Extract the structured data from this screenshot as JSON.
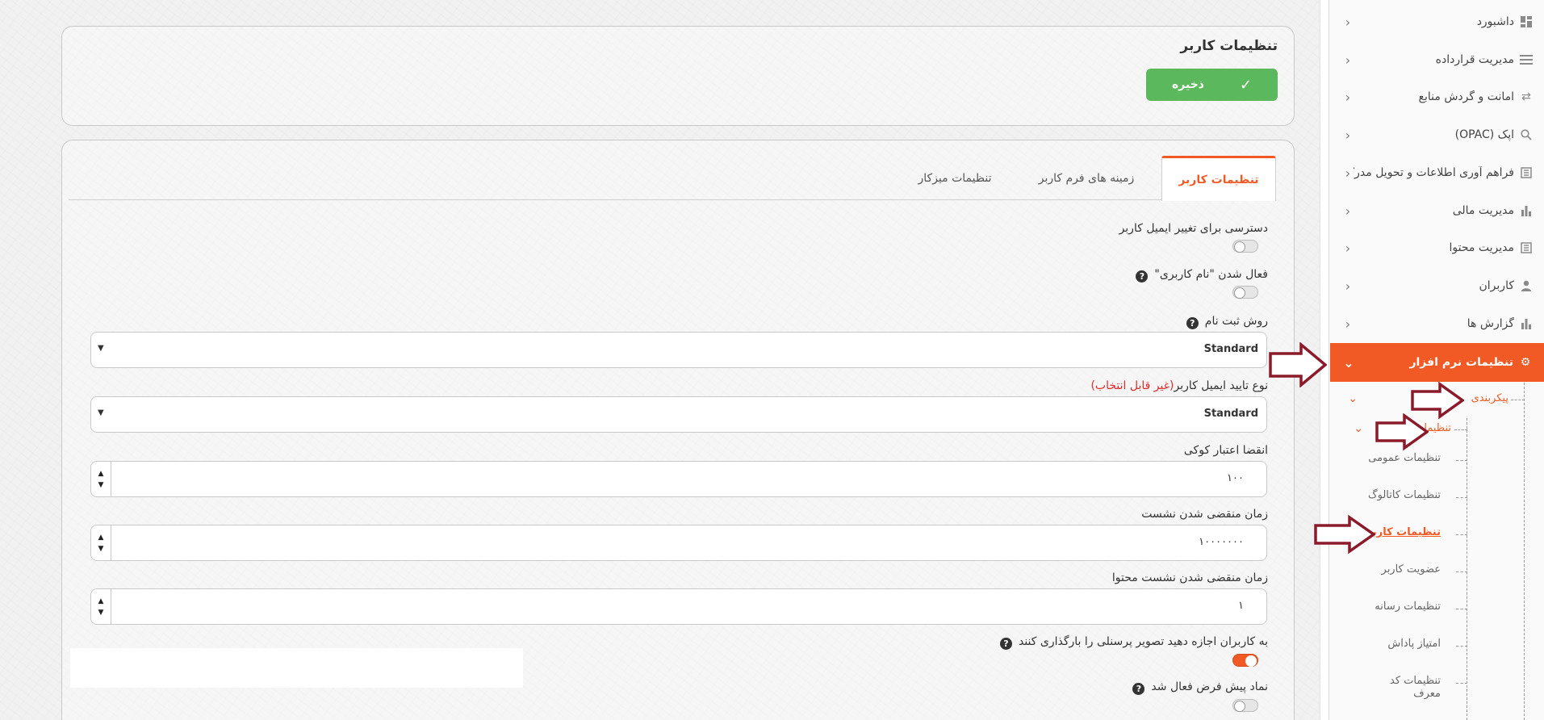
{
  "sidebar": {
    "items": [
      {
        "label": "داشبورد",
        "icon": "dashboard-icon"
      },
      {
        "label": "مدیریت قرارداده",
        "icon": "contract-icon"
      },
      {
        "label": "امانت و گردش منابع",
        "icon": "exchange-icon"
      },
      {
        "label": "اپک (OPAC)",
        "icon": "search-icon"
      },
      {
        "label": "فراهم آوری اطلاعات و تحویل مدرک",
        "icon": "book-icon"
      },
      {
        "label": "مدیریت مالی",
        "icon": "bar-chart-icon"
      },
      {
        "label": "مدیریت محتوا",
        "icon": "book-icon"
      },
      {
        "label": "کاربران",
        "icon": "user-icon"
      },
      {
        "label": "گزارش ها",
        "icon": "bar-chart-icon"
      },
      {
        "label": "تنظیمات نرم افزار",
        "icon": "gear-icon"
      }
    ],
    "config_label": "پیکربندی",
    "settings_label": "تنظیمات",
    "sub_items": [
      "تنظیمات عمومی",
      "تنظیمات کاتالوگ",
      "تنظیمات کاربر",
      "عضویت کاربر",
      "تنظیمات رسانه",
      "امتیاز پاداش",
      "تنظیمات کد",
      "معرف"
    ]
  },
  "header": {
    "title": "تنظیمات کاربر",
    "save_label": "ذخیره"
  },
  "tabs": [
    {
      "label": "تنظیمات کاربر",
      "active": true
    },
    {
      "label": "زمینه های فرم کاربر",
      "active": false
    },
    {
      "label": "تنظیمات میزکار",
      "active": false
    }
  ],
  "form": {
    "email_change_access": {
      "label": "دسترسی برای تغییر ایمیل کاربر",
      "enabled": false
    },
    "username_activation": {
      "label": "فعال شدن \"نام کاربری\"",
      "enabled": false
    },
    "registration_method": {
      "label": "روش ثبت نام",
      "value": "Standard"
    },
    "email_verification_type": {
      "label": "نوع تایید ایمیل کاربر",
      "note": "(غیر قابل انتخاب)",
      "value": "Standard"
    },
    "cookie_expiry": {
      "label": "انقضا اعتبار کوکی",
      "value": "۱۰۰"
    },
    "session_expiry": {
      "label": "زمان منقضی شدن نشست",
      "value": "۱۰۰۰۰۰۰۰"
    },
    "content_session_expiry": {
      "label": "زمان منقضی شدن نشست محتوا",
      "value": "۱"
    },
    "allow_personnel_photo": {
      "label": "به کاربران اجازه دهید تصویر پرسنلی را بارگذاری کنند",
      "enabled": true
    },
    "default_avatar": {
      "label": "نماد پیش فرض فعال شد",
      "enabled": false
    }
  },
  "colors": {
    "accent": "#f15a24",
    "save": "#5cb85c",
    "arrow": "#8b1a2b",
    "warn": "#e02b2b"
  }
}
